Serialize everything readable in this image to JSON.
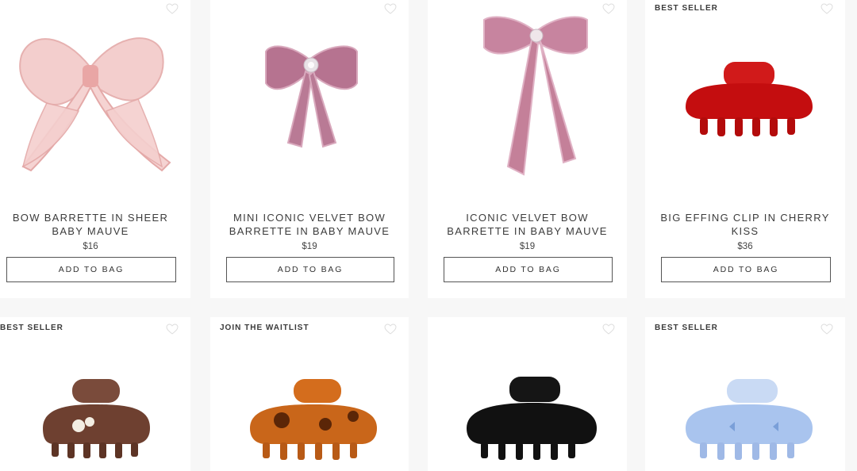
{
  "products": [
    {
      "name_line1": "BOW BARRETTE IN SHEER",
      "name_line2": "BABY MAUVE",
      "price": "$16",
      "button": "ADD TO BAG",
      "badge": "",
      "icon": "heart-icon"
    },
    {
      "name_line1": "MINI ICONIC VELVET BOW",
      "name_line2": "BARRETTE IN BABY MAUVE",
      "price": "$19",
      "button": "ADD TO BAG",
      "badge": "",
      "icon": "heart-icon"
    },
    {
      "name_line1": "ICONIC VELVET BOW",
      "name_line2": "BARRETTE IN BABY MAUVE",
      "price": "$19",
      "button": "ADD TO BAG",
      "badge": "",
      "icon": "heart-icon"
    },
    {
      "name_line1": "BIG EFFING CLIP IN CHERRY",
      "name_line2": "KISS",
      "price": "$36",
      "button": "ADD TO BAG",
      "badge": "BEST SELLER",
      "icon": "heart-icon"
    },
    {
      "badge": "BEST SELLER",
      "icon": "heart-icon"
    },
    {
      "badge": "JOIN THE WAITLIST",
      "icon": "heart-icon"
    },
    {
      "badge": "",
      "icon": "heart-icon"
    },
    {
      "badge": "BEST SELLER",
      "icon": "heart-icon"
    }
  ],
  "colors": {
    "background": "#f7f7f7",
    "card": "#ffffff",
    "text": "#3c3c3c",
    "border": "#555555"
  }
}
